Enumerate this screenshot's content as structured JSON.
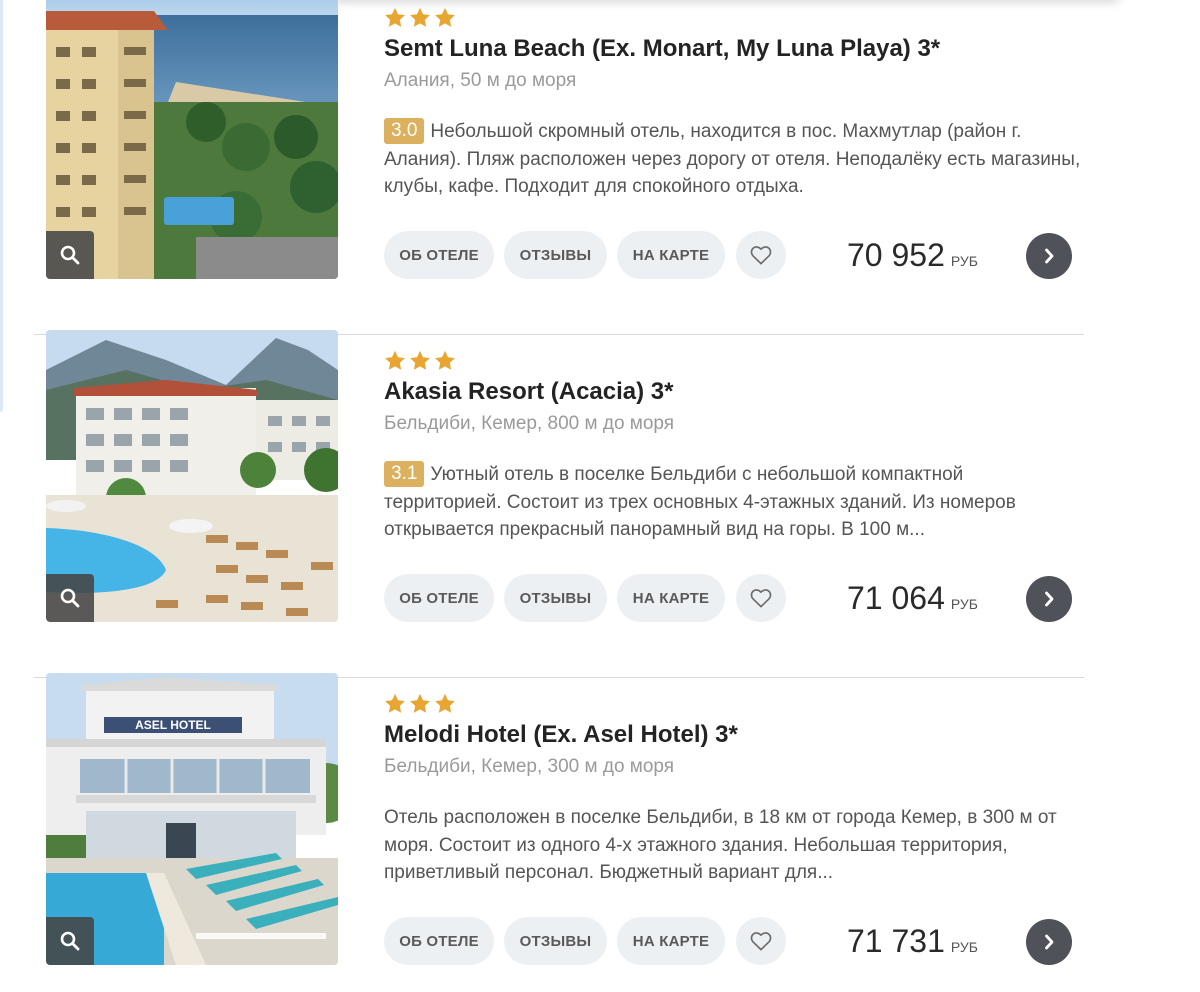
{
  "hotels": [
    {
      "stars": 3,
      "name": "Semt Luna Beach (Ex. Monart, My Luna Playa) 3*",
      "location": "Алания, 50 м до моря",
      "rating": "3.0",
      "description": "Небольшой скромный отель, находится в пос. Махмутлар (район г. Алания). Пляж расположен через дорогу от отеля. Неподалёку есть магазины, клубы, кафе. Подходит для спокойного отдыха.",
      "price": "70 952",
      "currency": "РУБ"
    },
    {
      "stars": 3,
      "name": "Akasia Resort (Acacia) 3*",
      "location": "Бельдиби, Кемер, 800 м до моря",
      "rating": "3.1",
      "description": "Уютный отель в поселке Бельдиби с небольшой компактной территорией. Состоит из трех основных 4-этажных зданий. Из номеров открывается прекрасный панорамный вид на горы. В 100 м...",
      "price": "71 064",
      "currency": "РУБ"
    },
    {
      "stars": 3,
      "name": "Melodi Hotel (Ex. Asel Hotel) 3*",
      "location": "Бельдиби, Кемер, 300 м до моря",
      "rating": "",
      "description": "Отель расположен в поселке Бельдиби, в 18 км от города Кемер, в 300 м от моря. Состоит из одного 4-х этажного здания. Небольшая территория, приветливый персонал. Бюджетный вариант для...",
      "price": "71 731",
      "currency": "РУБ"
    }
  ],
  "buttons": {
    "about": "ОБ ОТЕЛЕ",
    "reviews": "ОТЗЫВЫ",
    "map": "НА КАРТЕ"
  },
  "photo_sign": "ASEL HOTEL",
  "colors": {
    "star": "#e8a532",
    "rating_badge": "#dbb15f",
    "button_bg": "#edf0f3",
    "go_button": "#4f5259"
  },
  "icons": {
    "zoom": "search-icon",
    "favorite": "heart-icon",
    "go": "chevron-right-icon",
    "star": "star-icon"
  }
}
